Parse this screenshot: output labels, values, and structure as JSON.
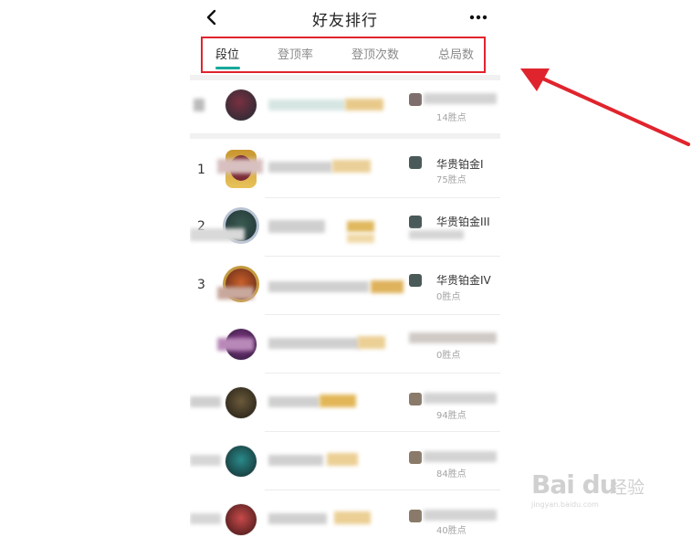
{
  "header": {
    "title": "好友排行",
    "back_icon": "chevron-left-icon",
    "more_icon": "more-dots-icon"
  },
  "tabs": [
    {
      "label": "段位",
      "active": true
    },
    {
      "label": "登顶率",
      "active": false
    },
    {
      "label": "登顶次数",
      "active": false
    },
    {
      "label": "总局数",
      "active": false
    }
  ],
  "accent_color": "#17a99b",
  "highlight_color": "#e0242d",
  "self_row": {
    "tier": "",
    "wins": "14胜点"
  },
  "ranking": [
    {
      "rank": "1",
      "tier": "华贵铂金I",
      "wins": "75胜点"
    },
    {
      "rank": "2",
      "tier": "华贵铂金III",
      "wins": ""
    },
    {
      "rank": "3",
      "tier": "华贵铂金IV",
      "wins": "0胜点"
    },
    {
      "rank": "",
      "tier": "",
      "wins": "0胜点"
    },
    {
      "rank": "",
      "tier": "",
      "wins": "94胜点"
    },
    {
      "rank": "",
      "tier": "",
      "wins": "84胜点"
    },
    {
      "rank": "",
      "tier": "",
      "wins": "40胜点"
    }
  ],
  "watermark": {
    "logo": "Bai du",
    "text": "经验",
    "url": "jingyan.baidu.com"
  }
}
